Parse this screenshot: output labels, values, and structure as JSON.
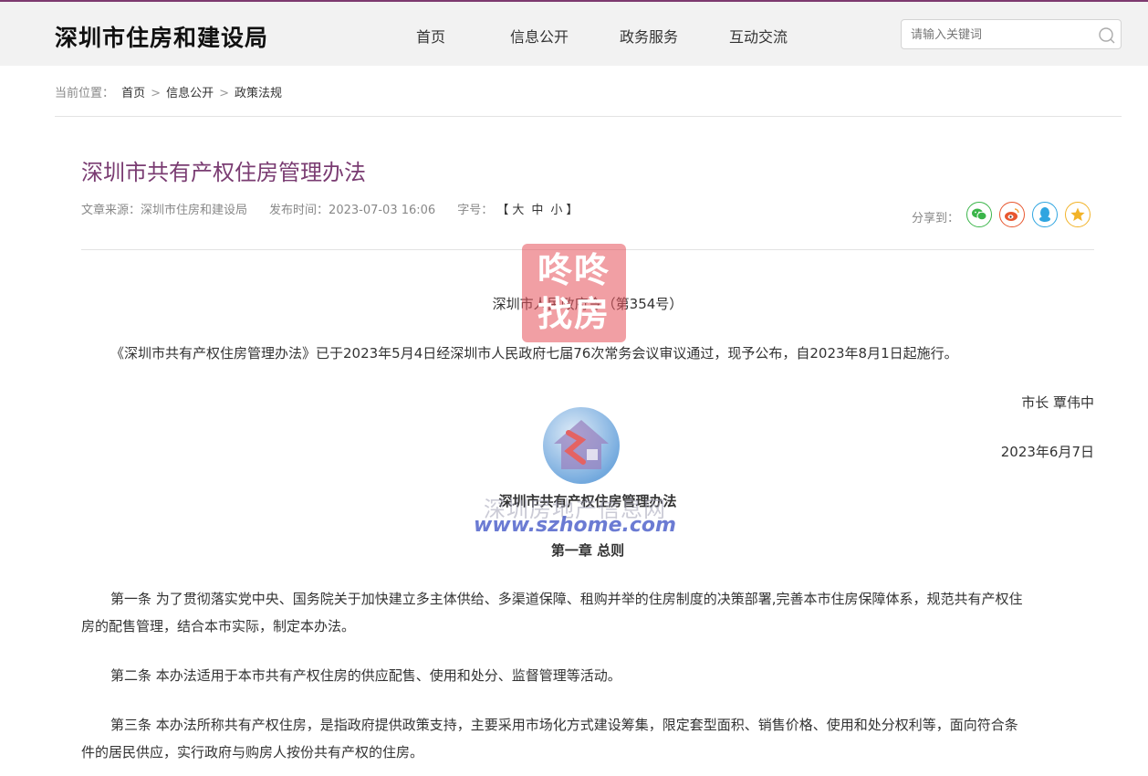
{
  "header": {
    "site_title": "深圳市住房和建设局",
    "nav": [
      "首页",
      "信息公开",
      "政务服务",
      "互动交流"
    ],
    "search_placeholder": "请输入关键词"
  },
  "breadcrumb": {
    "label": "当前位置：",
    "items": [
      "首页",
      "信息公开",
      "政策法规"
    ],
    "separator": ">"
  },
  "article": {
    "title": "深圳市共有产权住房管理办法",
    "source_label": "文章来源：",
    "source": "深圳市住房和建设局",
    "time_label": "发布时间：",
    "time": "2023-07-03 16:06",
    "fontsize_label": "字号：",
    "fontsize_open": "【",
    "fontsize_options": [
      "大",
      "中",
      "小"
    ],
    "fontsize_close": "】",
    "share_label": "分享到：",
    "share_buttons": [
      "wechat-icon",
      "weibo-icon",
      "qq-icon",
      "favorite-star-icon"
    ],
    "order_line": "深圳市人民政府令（第354号）",
    "announcement": "《深圳市共有产权住房管理办法》已于2023年5月4日经深圳市人民政府七届76次常务会议审议通过，现予公布，自2023年8月1日起施行。",
    "mayor": "市长  覃伟中",
    "date": "2023年6月7日",
    "doc_title": "深圳市共有产权住房管理办法",
    "chapter": "第一章  总则",
    "articles": [
      {
        "line1": "第一条  为了贯彻落实党中央、国务院关于加快建立多主体供给、多渠道保障、租购并举的住房制度的决策部署,完善本市住房保障体系，规范共有产权住",
        "line2": "房的配售管理，结合本市实际，制定本办法。"
      },
      {
        "line1": "第二条  本办法适用于本市共有产权住房的供应配售、使用和处分、监督管理等活动。",
        "line2": ""
      },
      {
        "line1": "第三条  本办法所称共有产权住房，是指政府提供政策支持，主要采用市场化方式建设筹集，限定套型面积、销售价格、使用和处分权利等，面向符合条",
        "line2": "件的居民供应，实行政府与购房人按份共有产权的住房。"
      }
    ]
  },
  "watermarks": {
    "brand_line1": "咚咚",
    "brand_line2": "找房",
    "site_name": "深圳房地产信息网",
    "site_url": "www.szhome.com"
  },
  "colors": {
    "accent": "#7a3c72",
    "wechat": "#3bb54a",
    "weibo": "#e8572f",
    "qq": "#2fa5e0",
    "favorite": "#f2b328"
  }
}
